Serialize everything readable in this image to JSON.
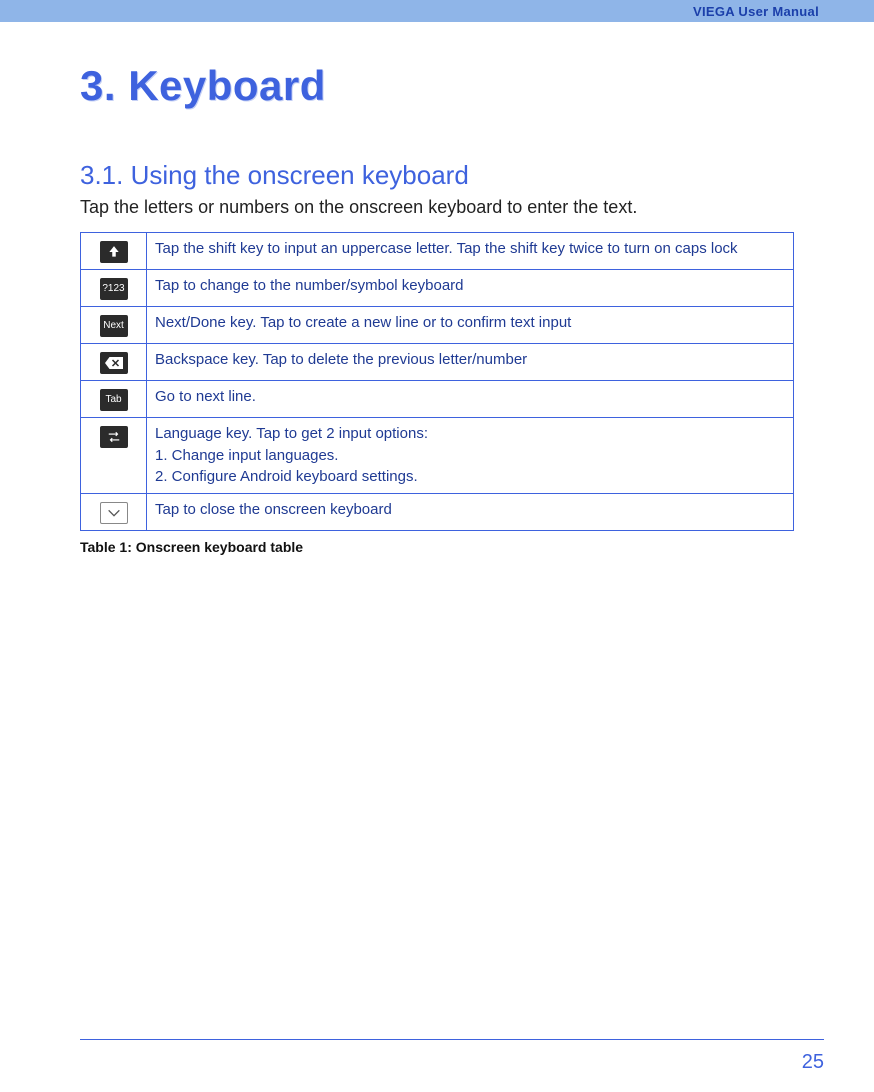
{
  "header": {
    "title": "VIEGA User Manual"
  },
  "chapter": {
    "heading": "3. Keyboard"
  },
  "section": {
    "heading": "3.1. Using the onscreen keyboard",
    "intro": "Tap the letters or numbers on the onscreen keyboard to enter the text."
  },
  "table": {
    "rows": [
      {
        "icon": "shift-icon",
        "desc": "Tap the shift key to input an uppercase letter. Tap the shift key twice to turn on caps lock"
      },
      {
        "icon": "num-sym-icon",
        "icon_text": "?123",
        "desc": "Tap to change to the number/symbol keyboard"
      },
      {
        "icon": "next-icon",
        "icon_text": "Next",
        "desc": "Next/Done key. Tap to create a new line or to confirm text input"
      },
      {
        "icon": "backspace-icon",
        "desc": "Backspace key. Tap to delete the previous letter/number"
      },
      {
        "icon": "tab-icon",
        "icon_text": "Tab",
        "desc": "Go to next line."
      },
      {
        "icon": "language-icon",
        "desc": "Language key. Tap to get 2 input options:",
        "sub": [
          "1. Change input languages.",
          "2. Configure Android keyboard settings."
        ]
      },
      {
        "icon": "close-kb-icon",
        "desc": "Tap to close the onscreen keyboard"
      }
    ],
    "caption": "Table 1: Onscreen keyboard table"
  },
  "footer": {
    "page_number": "25"
  }
}
